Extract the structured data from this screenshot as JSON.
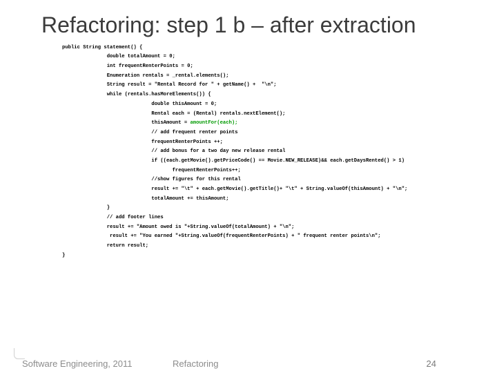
{
  "title": "Refactoring: step 1 b – after extraction",
  "code": {
    "l01": "public String statement() {",
    "l02": "               double totalAmount = 0;",
    "l03": "               int frequentRenterPoints = 0;",
    "l04": "               Enumeration rentals = _rental.elements();",
    "l05": "               String result = \"Rental Record for \" + getName() +  \"\\n\";",
    "l06": "               while (rentals.hasMoreElements()) {",
    "l07": "                              double thisAmount = 0;",
    "l08": "                              Rental each = (Rental) rentals.nextElement();",
    "l09a": "                              thisAmount = ",
    "l09b": "amountFor(each);",
    "l10": "                              // add frequent renter points",
    "l11": "                              frequentRenterPoints ++;",
    "l12": "                              // add bonus for a two day new release rental",
    "l13": "                              if ((each.getMovie().getPriceCode() == Movie.NEW_RELEASE)&& each.getDaysRented() > 1)",
    "l14": "                                     frequentRenterPoints++;",
    "l15": "                              //show figures for this rental",
    "l16": "                              result += \"\\t\" + each.getMovie().getTitle()+ \"\\t\" + String.valueOf(thisAmount) + \"\\n\";",
    "l17": "                              totalAmount += thisAmount;",
    "l18": "               }",
    "l19": "               // add footer lines",
    "l20": "               result += \"Amount owed is \"+String.valueOf(totalAmount) + \"\\n\";",
    "l21": "                result += \"You earned \"+String.valueOf(frequentRenterPoints) + \" frequent renter points\\n\";",
    "l22": "               return result;",
    "l23": "}"
  },
  "footer": {
    "left": "Software Engineering, 2011",
    "center": "Refactoring",
    "page": "24"
  }
}
